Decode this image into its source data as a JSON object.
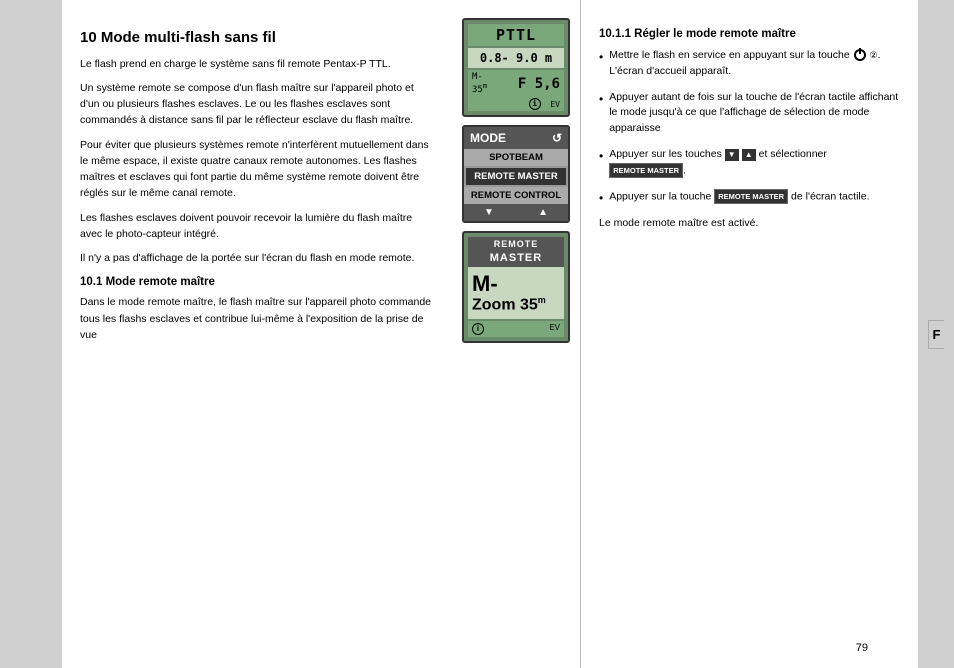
{
  "page": {
    "number": "79",
    "left_margin_color": "#d0d0d0",
    "right_tab_label": "F"
  },
  "section": {
    "title": "10 Mode multi-flash sans fil",
    "intro_paragraphs": [
      "Le flash prend en charge le système sans fil remote Pentax-P TTL.",
      "Un système remote se compose d'un flash maître sur l'appareil photo et d'un ou plusieurs flashes esclaves. Le ou les flashes esclaves sont commandés à distance sans fil par le réflecteur esclave du flash maître.",
      "Pour éviter que plusieurs systèmes remote n'interfèrent mutuellement dans le même espace, il existe quatre canaux remote autonomes. Les flashes maîtres et esclaves qui font partie du même système remote doivent être réglés sur le même canal remote.",
      "Les flashes esclaves doivent pouvoir recevoir la lumière du flash maître avec le photo-capteur intégré.",
      "Il n'y a pas d'affichage de la portée sur l'écran du flash en mode remote."
    ],
    "subsection_10_1": {
      "title": "10.1 Mode remote maître",
      "text": "Dans le mode remote maître, le flash maître sur l'appareil photo commande tous les flashs esclaves et contribue lui-même à l'exposition de la prise de vue"
    },
    "subsection_10_1_1": {
      "title": "10.1.1 Régler le mode remote maître",
      "bullets": [
        {
          "id": "bullet1",
          "text_parts": [
            "Mettre le flash en service en appuyant sur la touche",
            "power",
            ".",
            "L'écran d'accueil apparaît."
          ]
        },
        {
          "id": "bullet2",
          "text": "Appuyer autant de fois sur la touche de l'écran tactile affichant le mode jusqu'à ce que l'affichage de sélection de mode apparaisse"
        },
        {
          "id": "bullet3",
          "text_parts": [
            "Appuyer sur les touches",
            "nav_down",
            "nav_up",
            "et sélectionner",
            "REMOTE MASTER",
            "."
          ]
        },
        {
          "id": "bullet4",
          "text_parts": [
            "Appuyer sur la touche",
            "REMOTE MASTER",
            "de l'écran tactile."
          ]
        }
      ]
    },
    "confirm_text": "Le mode remote maître est activé."
  },
  "device": {
    "top_display": {
      "mode": "PTTL",
      "range": "0.8- 9.0 m",
      "zoom_label": "M-",
      "zoom_value": "35",
      "zoom_unit": "m/m",
      "aperture": "F 5,6",
      "ev_label": "EV",
      "info_icon": "i"
    },
    "mode_selector": {
      "label": "MODE",
      "undo_icon": "↺",
      "items": [
        "SPOTBEAM",
        "REMOTE MASTER",
        "REMOTE CONTROL"
      ],
      "selected": "REMOTE MASTER",
      "arrows": [
        "▼",
        "▲"
      ]
    },
    "bottom_display": {
      "header_line1": "REMOTE",
      "header_line2": "MASTER",
      "mzoom_prefix": "M-",
      "zoom_value": "Zoom 35",
      "zoom_unit": "m",
      "info_icon": "i",
      "ev_label": "EV"
    }
  }
}
